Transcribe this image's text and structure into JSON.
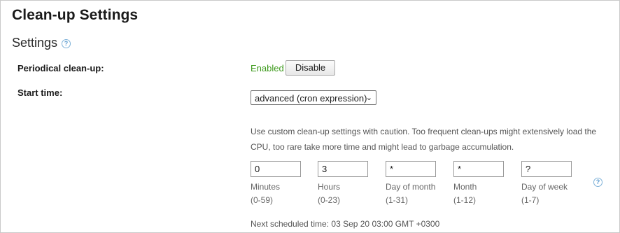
{
  "page": {
    "title": "Clean-up Settings"
  },
  "settings": {
    "title": "Settings",
    "help_icon": "question-circle-icon",
    "periodical": {
      "label": "Periodical clean-up:",
      "status": "Enabled",
      "button": "Disable"
    },
    "start_time": {
      "label": "Start time:",
      "selected": "advanced (cron expression)"
    },
    "note": "Use custom clean-up settings with caution. Too frequent clean-ups might extensively load the CPU, too rare take more time and might lead to garbage accumulation.",
    "cron": [
      {
        "value": "0",
        "label": "Minutes",
        "range": "(0-59)"
      },
      {
        "value": "3",
        "label": "Hours",
        "range": "(0-23)"
      },
      {
        "value": "*",
        "label": "Day of month",
        "range": "(1-31)"
      },
      {
        "value": "*",
        "label": "Month",
        "range": "(1-12)"
      },
      {
        "value": "?",
        "label": "Day of week",
        "range": "(1-7)"
      }
    ],
    "cron_help_icon": "question-circle-icon",
    "next_scheduled": "Next scheduled time: 03 Sep 20 03:00 GMT +0300"
  },
  "colors": {
    "enabled": "#3d9a1c",
    "help_icon": "#5a9bd0"
  }
}
